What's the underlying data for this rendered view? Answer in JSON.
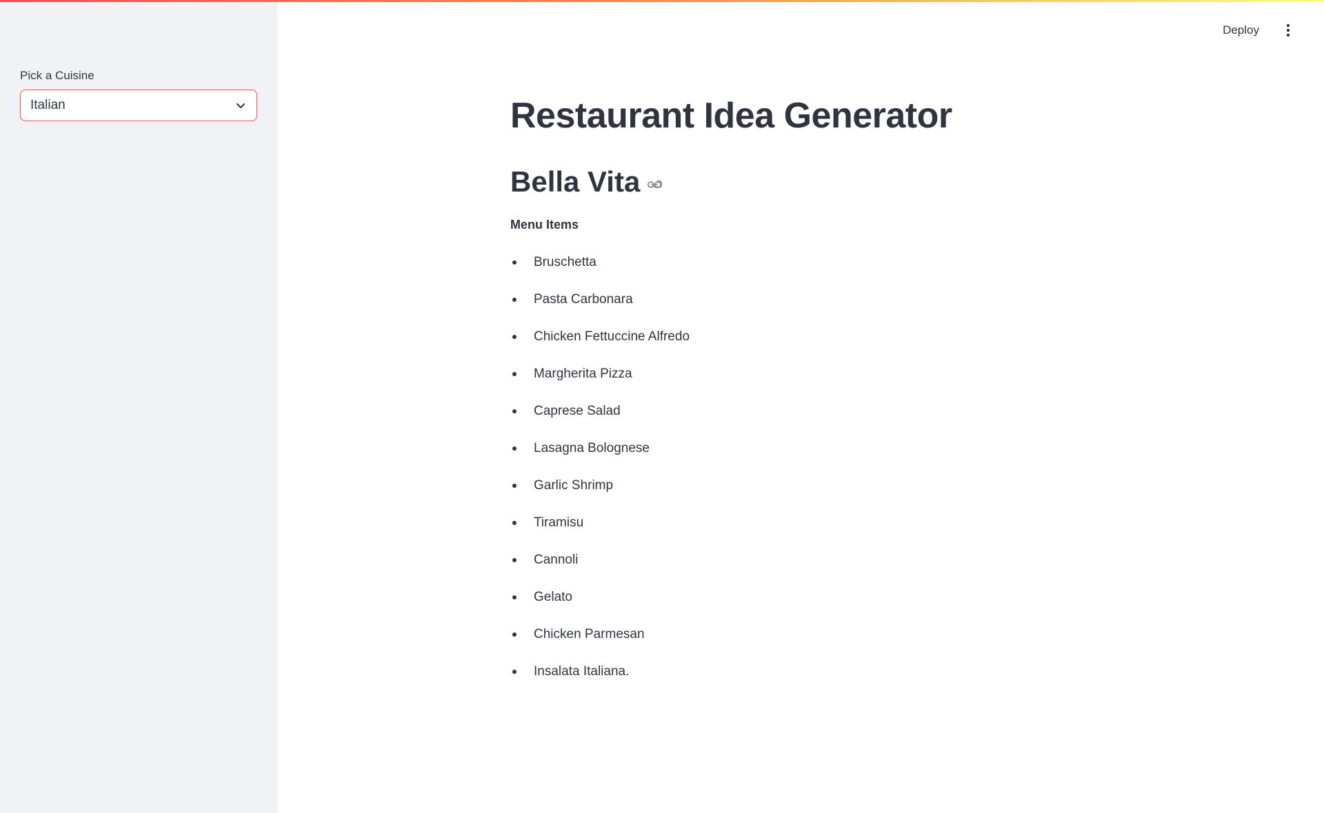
{
  "header": {
    "deploy_label": "Deploy",
    "menu_icon": "more-vertical-icon"
  },
  "sidebar": {
    "select_label": "Pick a Cuisine",
    "select_value": "Italian",
    "chevron_icon": "chevron-down-icon"
  },
  "main": {
    "title": "Restaurant Idea Generator",
    "restaurant_name": "Bella Vita",
    "link_icon": "link-icon",
    "menu_heading": "Menu Items",
    "menu_items": [
      "Bruschetta",
      "Pasta Carbonara",
      "Chicken Fettuccine Alfredo",
      "Margherita Pizza",
      "Caprese Salad",
      "Lasagna Bolognese",
      "Garlic Shrimp",
      "Tiramisu",
      "Cannoli",
      "Gelato",
      "Chicken Parmesan",
      "Insalata Italiana."
    ]
  },
  "colors": {
    "accent": "#ff4b4b",
    "sidebar_bg": "#f0f2f6",
    "text": "#31333f"
  }
}
